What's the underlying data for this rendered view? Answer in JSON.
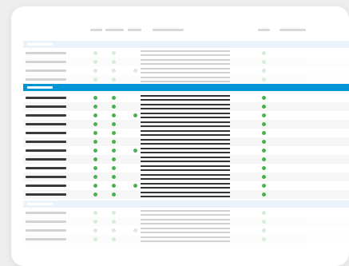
{
  "colors": {
    "accent": "#0095d5",
    "group_band": "#eaf3fb",
    "status_green": "#4caf50",
    "text_dark": "#3a3a3a"
  },
  "table": {
    "columns": [
      "",
      "",
      "",
      "",
      "",
      ""
    ],
    "groups": [
      {
        "label": "",
        "state": "collapsed"
      },
      {
        "label": "",
        "state": "selected"
      },
      {
        "label": "",
        "state": "collapsed"
      }
    ]
  }
}
